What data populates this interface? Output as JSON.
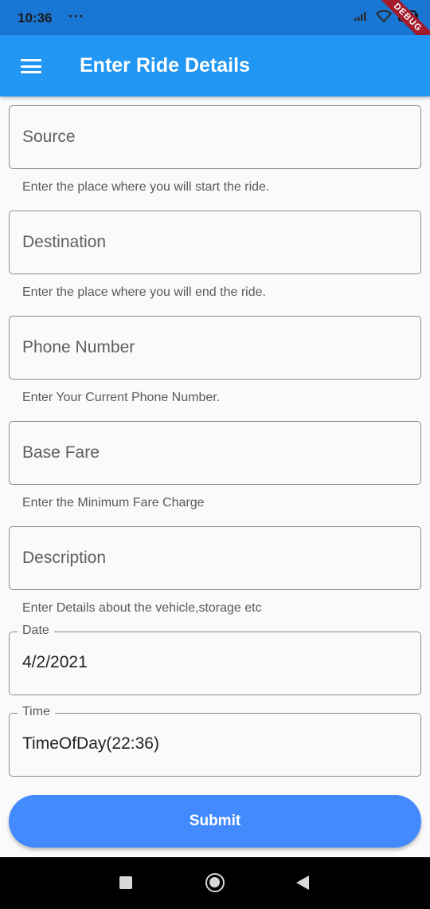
{
  "status_bar": {
    "time": "10:36",
    "dots": "···",
    "debug_label": "DEBUG"
  },
  "app_bar": {
    "title": "Enter Ride Details",
    "menu_icon": "menu-icon"
  },
  "form": {
    "source": {
      "placeholder": "Source",
      "helper": "Enter the place where you will start the ride."
    },
    "destination": {
      "placeholder": "Destination",
      "helper": "Enter the place where you will end the ride."
    },
    "phone": {
      "placeholder": "Phone Number",
      "helper": "Enter Your Current Phone Number."
    },
    "base_fare": {
      "placeholder": "Base Fare",
      "helper": "Enter the Minimum Fare Charge"
    },
    "description": {
      "placeholder": "Description",
      "helper": "Enter Details about the vehicle,storage etc"
    },
    "date": {
      "label": "Date",
      "value": "4/2/2021"
    },
    "time": {
      "label": "Time",
      "value": "TimeOfDay(22:36)"
    },
    "submit_label": "Submit"
  },
  "colors": {
    "status_bar": "#1976d2",
    "app_bar": "#2196f3",
    "button": "#448aff",
    "debug_ribbon": "#a11b2b"
  }
}
